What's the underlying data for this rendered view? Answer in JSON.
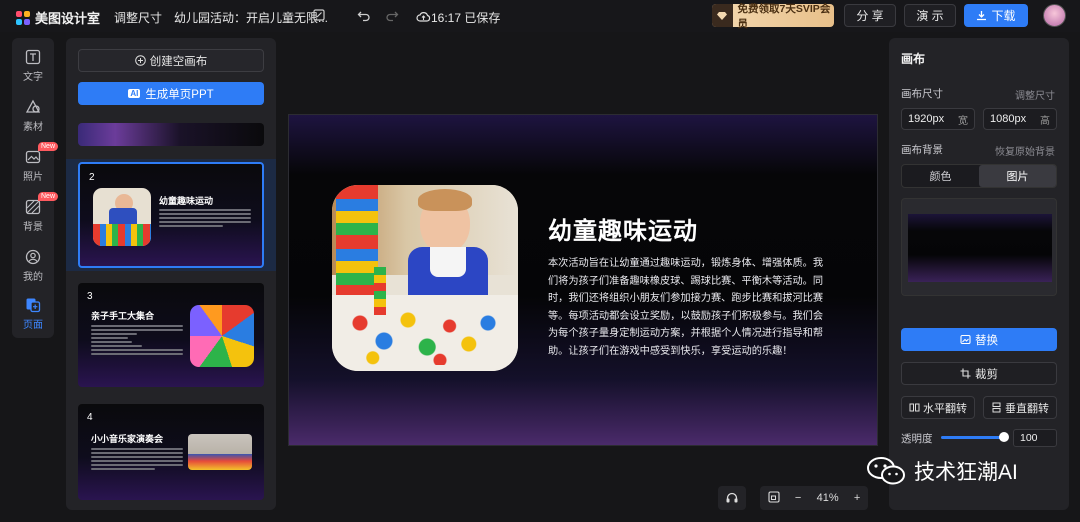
{
  "app": {
    "name": "美图设计室",
    "resize_label": "调整尺寸",
    "doc_title": "幼儿园活动：开启儿童无限...",
    "save_status": "16:17 已保存"
  },
  "topbar": {
    "vip_label": "免费领取7天SVIP会员",
    "share_label": "分 享",
    "present_label": "演 示",
    "download_label": "下载"
  },
  "leftnav": {
    "items": [
      {
        "label": "文字",
        "icon": "text-icon"
      },
      {
        "label": "素材",
        "icon": "shapes-icon"
      },
      {
        "label": "照片",
        "icon": "photo-icon",
        "badge": "New"
      },
      {
        "label": "背景",
        "icon": "background-icon",
        "badge": "New"
      },
      {
        "label": "我的",
        "icon": "user-icon"
      },
      {
        "label": "页面",
        "icon": "pages-icon",
        "active": true
      }
    ]
  },
  "pages_panel": {
    "create_label": "创建空画布",
    "generate_ai_tag": "AI",
    "generate_label": "生成单页PPT",
    "thumbs": [
      {
        "num": "2",
        "title": "幼童趣味运动"
      },
      {
        "num": "3",
        "title": "亲子手工大集合"
      },
      {
        "num": "4",
        "title": "小小音乐家演奏会"
      }
    ]
  },
  "slide": {
    "title": "幼童趣味运动",
    "body": "本次活动旨在让幼童通过趣味运动，锻炼身体、增强体质。我们将为孩子们准备趣味橡皮球、踢球比赛、平衡木等活动。同时，我们还将组织小朋友们参加接力赛、跑步比赛和拔河比赛等。每项活动都会设立奖励，以鼓励孩子们积极参与。我们会为每个孩子量身定制运动方案，并根据个人情况进行指导和帮助。让孩子们在游戏中感受到快乐，享受运动的乐趣！"
  },
  "zoom": {
    "value": "41%",
    "minus": "−",
    "plus": "+"
  },
  "right_panel": {
    "title": "画布",
    "size_label": "画布尺寸",
    "resize_link": "调整尺寸",
    "width_value": "1920px",
    "width_unit": "宽",
    "height_value": "1080px",
    "height_unit": "高",
    "bg_label": "画布背景",
    "restore_link": "恢复原始背景",
    "tab_color": "颜色",
    "tab_image": "图片",
    "replace_label": "替换",
    "crop_label": "裁剪",
    "flip_h_label": "水平翻转",
    "flip_v_label": "垂直翻转",
    "opacity_label": "透明度",
    "opacity_value": "100"
  },
  "watermark": {
    "text": "技术狂潮AI"
  },
  "colors": {
    "accent": "#2e7cf6",
    "panel": "#232327",
    "background": "#161618"
  }
}
